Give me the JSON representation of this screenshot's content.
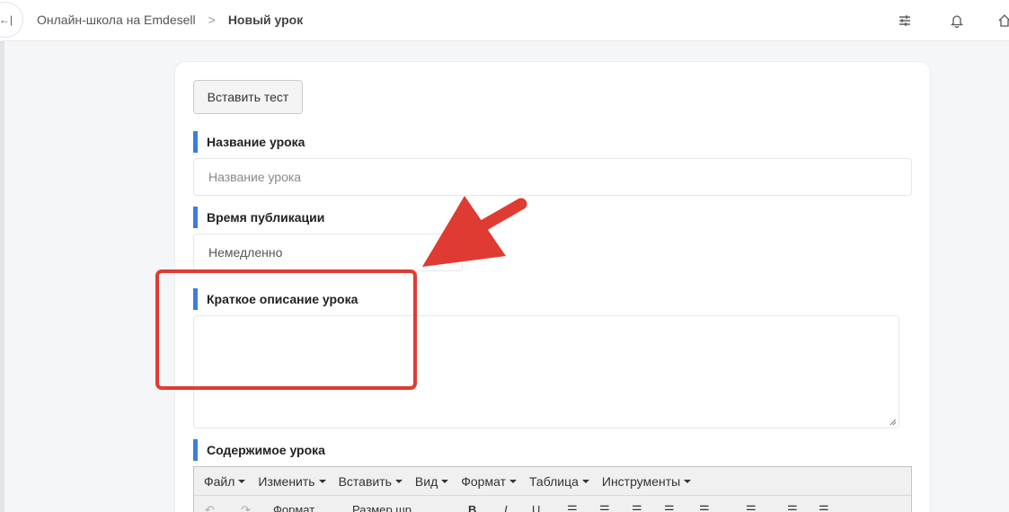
{
  "breadcrumb": {
    "school": "Онлайн-школа на Emdesell",
    "separator": ">",
    "current": "Новый урок"
  },
  "topbar": {
    "collapse_glyph": "←|",
    "icons": [
      "sliders-icon",
      "bell-icon",
      "home-icon"
    ]
  },
  "form": {
    "insert_test_label": "Вставить тест",
    "lesson_name_label": "Название урока",
    "lesson_name_placeholder": "Название урока",
    "publish_time_label": "Время публикации",
    "publish_time_value": "Немедленно",
    "short_description_label": "Краткое описание урока",
    "short_description_value": "",
    "content_label": "Содержимое урока"
  },
  "editor": {
    "menu": [
      "Файл",
      "Изменить",
      "Вставить",
      "Вид",
      "Формат",
      "Таблица",
      "Инструменты"
    ],
    "toolbar_format": "Формат",
    "toolbar_font_size": "Размер шр",
    "toolbar_bold": "B",
    "toolbar_italic": "I",
    "toolbar_underline": "U"
  },
  "colors": {
    "accent": "#3b7ddd",
    "annotation": "#e03b32"
  }
}
